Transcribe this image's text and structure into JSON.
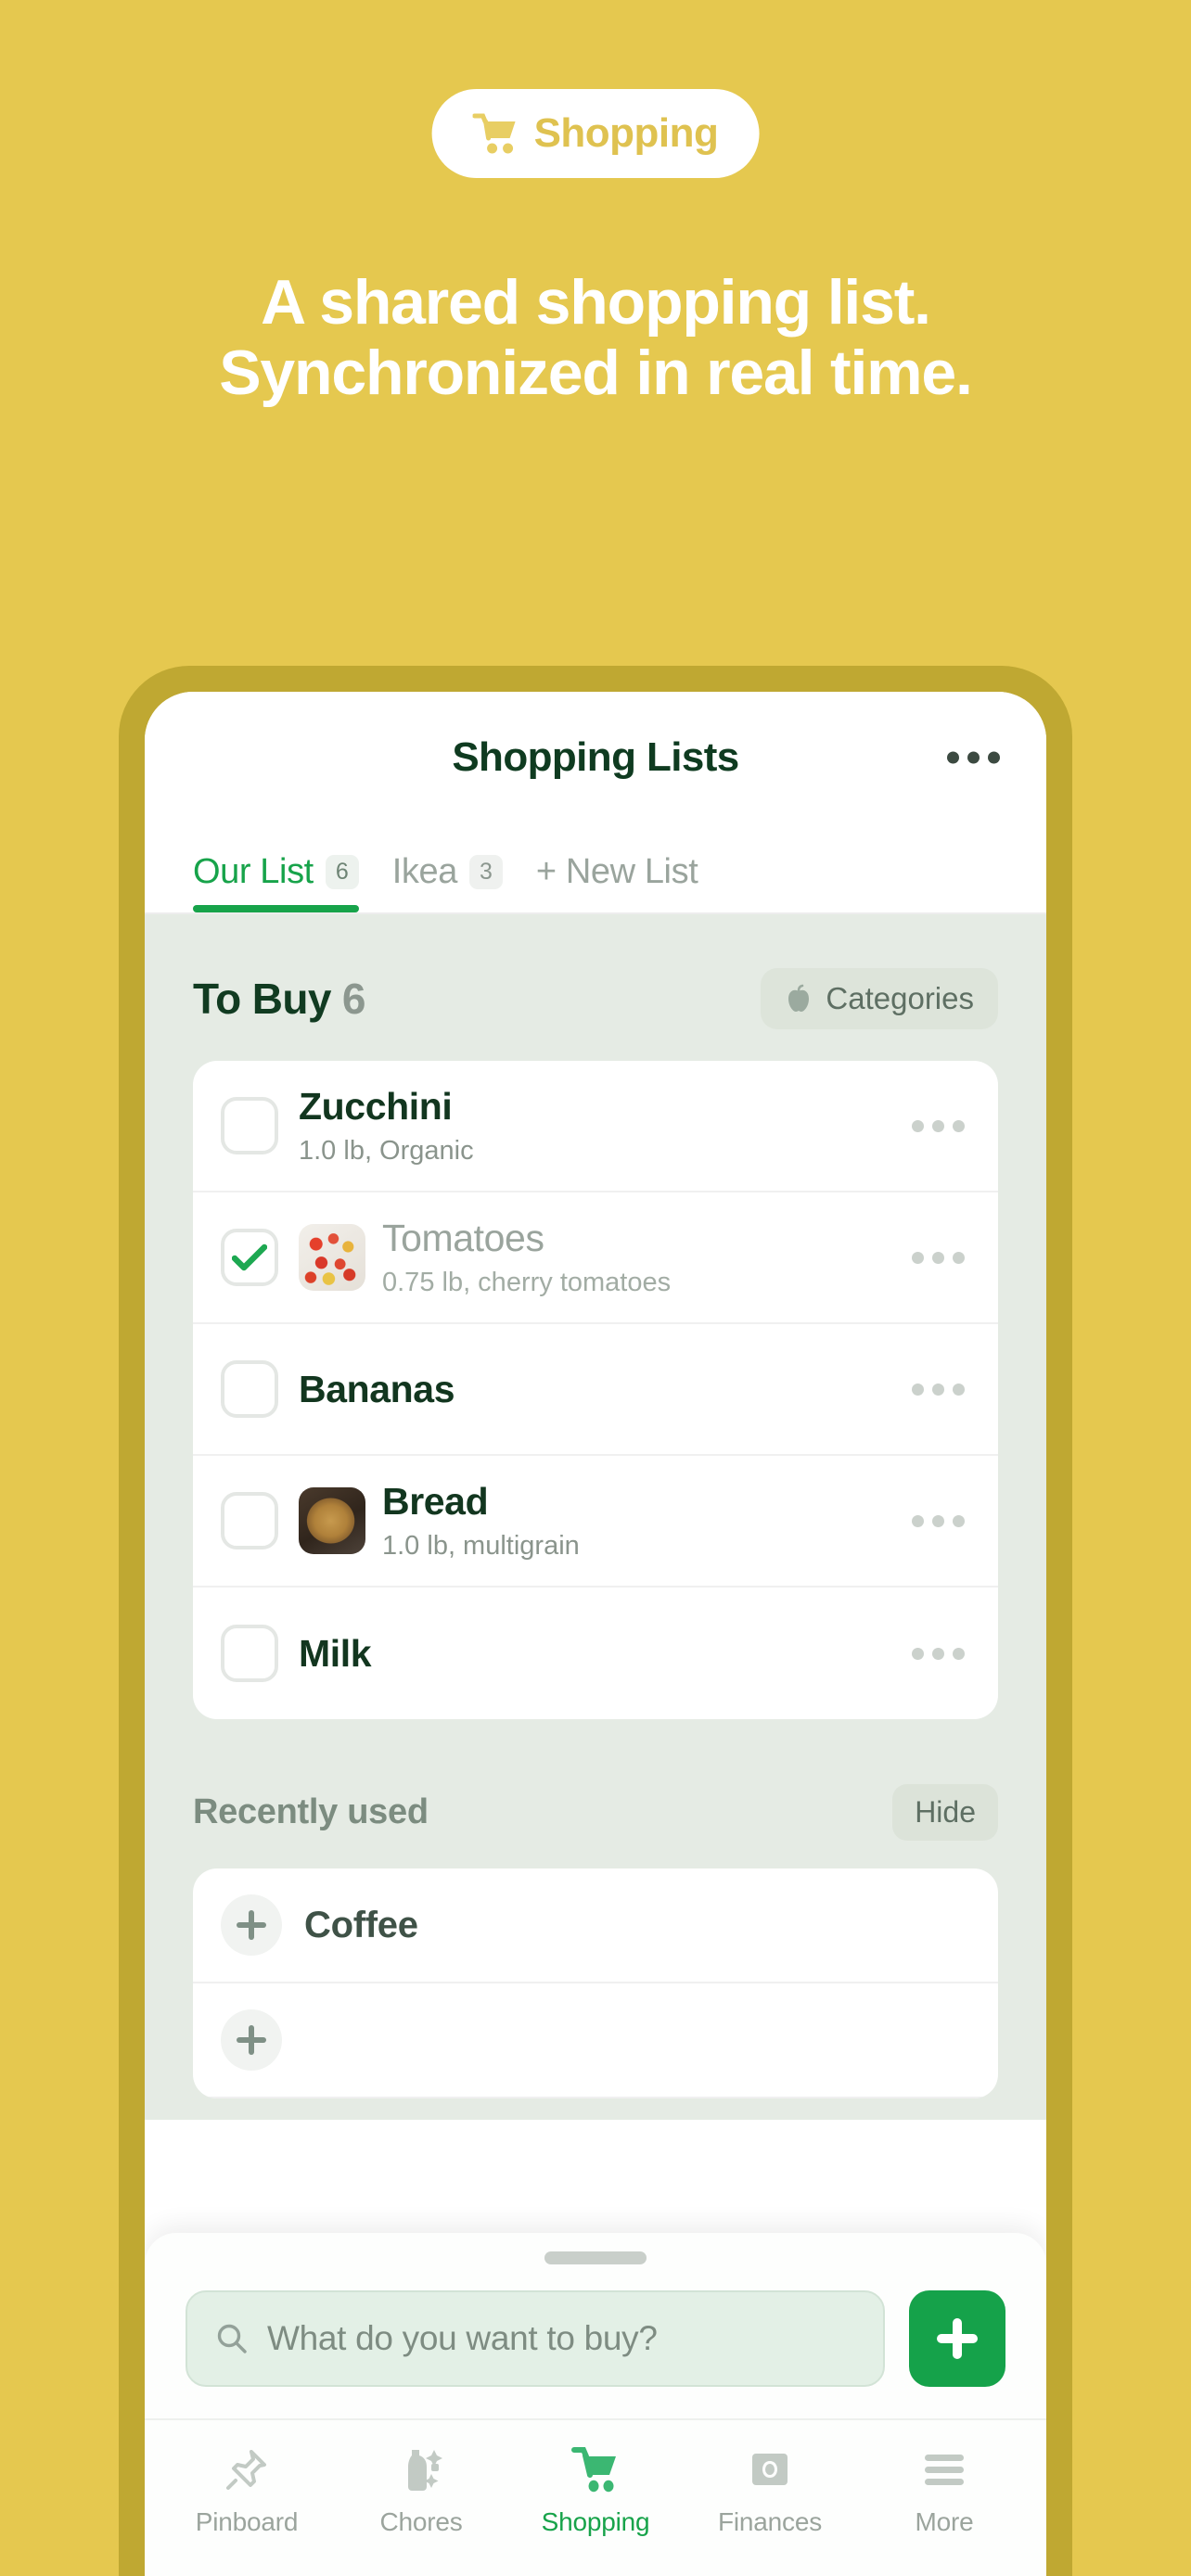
{
  "promo": {
    "badge_label": "Shopping",
    "badge_icon": "shopping-cart-icon",
    "headline": "A shared shopping list. Synchronized in real time.",
    "background_color": "#E5C84F",
    "badge_text_color": "#DFC250"
  },
  "phone": {
    "frame_color": "#BFA832",
    "screen_color": "#FFFFFF"
  },
  "app": {
    "title": "Shopping Lists",
    "more_icon": "more-horizontal-icon",
    "accent_color": "#17A34A",
    "tabs": [
      {
        "label": "Our List",
        "count": "6",
        "active": true
      },
      {
        "label": "Ikea",
        "count": "3",
        "active": false
      },
      {
        "label": "+ New List",
        "count": "",
        "active": false
      }
    ],
    "to_buy": {
      "title": "To Buy",
      "count": "6",
      "categories_button": {
        "label": "Categories",
        "icon": "apple-icon"
      },
      "items": [
        {
          "name": "Zucchini",
          "subtitle": "1.0 lb, Organic",
          "checked": false,
          "thumb": "",
          "more_icon": "more-horizontal-icon"
        },
        {
          "name": "Tomatoes",
          "subtitle": "0.75 lb, cherry tomatoes",
          "checked": true,
          "thumb": "tomatoes",
          "more_icon": "more-horizontal-icon"
        },
        {
          "name": "Bananas",
          "subtitle": "",
          "checked": false,
          "thumb": "",
          "more_icon": "more-horizontal-icon"
        },
        {
          "name": "Bread",
          "subtitle": "1.0 lb, multigrain",
          "checked": false,
          "thumb": "bread",
          "more_icon": "more-horizontal-icon"
        },
        {
          "name": "Milk",
          "subtitle": "",
          "checked": false,
          "thumb": "",
          "more_icon": "more-horizontal-icon"
        }
      ]
    },
    "recently_used": {
      "title": "Recently used",
      "hide_label": "Hide",
      "items": [
        {
          "name": "Coffee",
          "add_icon": "plus-icon"
        }
      ]
    },
    "composer": {
      "placeholder": "What do you want to buy?",
      "search_icon": "search-icon",
      "add_icon": "plus-icon",
      "add_button_color": "#15A24A"
    },
    "tabbar": [
      {
        "label": "Pinboard",
        "icon": "pin-icon",
        "active": false
      },
      {
        "label": "Chores",
        "icon": "spray-bottle-icon",
        "active": false
      },
      {
        "label": "Shopping",
        "icon": "shopping-cart-icon",
        "active": true
      },
      {
        "label": "Finances",
        "icon": "banknote-icon",
        "active": false
      },
      {
        "label": "More",
        "icon": "hamburger-menu-icon",
        "active": false
      }
    ]
  }
}
